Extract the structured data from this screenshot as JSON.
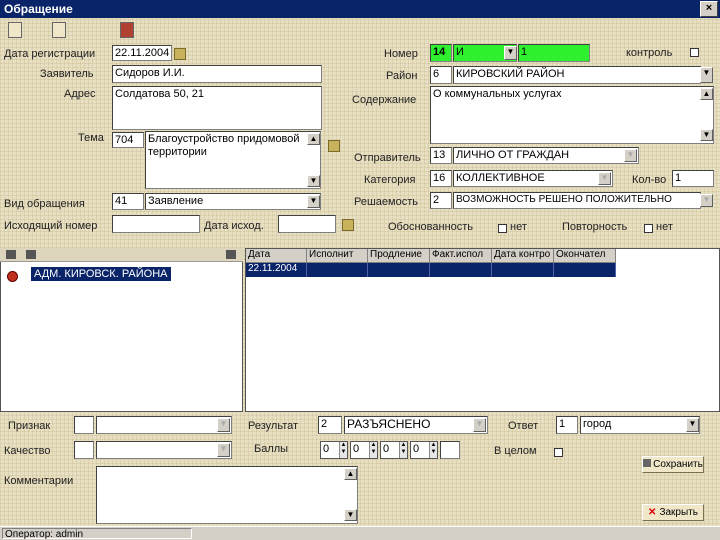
{
  "window": {
    "title": "Обращение",
    "close": "×"
  },
  "toolbar": {
    "icons": [
      "new-icon",
      "edit-icon",
      "book-icon"
    ]
  },
  "form": {
    "date_reg_label": "Дата регистрации",
    "date_reg_value": "22.11.2004",
    "applicant_label": "Заявитель",
    "applicant_value": "Сидоров И.И.",
    "address_label": "Адрес",
    "address_value": "Солдатова 50, 21",
    "topic_label": "Тема",
    "topic_code": "704",
    "topic_value": "Благоустройство придомовой территории",
    "appeal_type_label": "Вид обращения",
    "appeal_type_code": "41",
    "appeal_type_value": "Заявление",
    "outgoing_num_label": "Исходящий номер",
    "outgoing_date_label": "Дата исход.",
    "number_label": "Номер",
    "number_prefix": "14",
    "number_letter": "И",
    "number_value": "1",
    "control_label": "контроль",
    "district_label": "Район",
    "district_code": "6",
    "district_value": "КИРОВСКИЙ РАЙОН",
    "content_label": "Содержание",
    "content_value": "О коммунальных услугах",
    "sender_label": "Отправитель",
    "sender_code": "13",
    "sender_value": "ЛИЧНО ОТ ГРАЖДАН",
    "category_label": "Категория",
    "category_code": "16",
    "category_value": "КОЛЛЕКТИВНОЕ",
    "count_label": "Кол-во",
    "count_value": "1",
    "decision_label": "Решаемость",
    "decision_code": "2",
    "decision_value": "ВОЗМОЖНОСТЬ РЕШЕНО ПОЛОЖИТЕЛЬНО",
    "validity_label": "Обоснованность",
    "validity_no": "нет",
    "repeat_label": "Повторность",
    "repeat_no": "нет"
  },
  "tree": {
    "item": "АДМ. КИРОВСК. РАЙОНА"
  },
  "grid": {
    "columns": [
      "Дата",
      "Исполнит",
      "Продление",
      "Факт.испол",
      "Дата контро",
      "Окончател"
    ],
    "rows": [
      [
        "22.11.2004",
        "",
        "",
        "",
        "",
        ""
      ]
    ]
  },
  "bottom": {
    "sign_label": "Признак",
    "quality_label": "Качество",
    "result_label": "Результат",
    "result_code": "2",
    "result_value": "РАЗЪЯСНЕНО",
    "scores_label": "Баллы",
    "scores": [
      "0",
      "0",
      "0",
      "0"
    ],
    "answer_label": "Ответ",
    "answer_code": "1",
    "answer_value": "город",
    "in_work_label": "В целом",
    "comments_label": "Комментарии",
    "save_label": "Сохранить",
    "close_label": "Закрыть"
  },
  "status": {
    "operator": "Оператор: admin"
  },
  "colors": {
    "title_bar": "#0a246a",
    "number_green": "#2ff02f",
    "selection": "#0a246a"
  }
}
